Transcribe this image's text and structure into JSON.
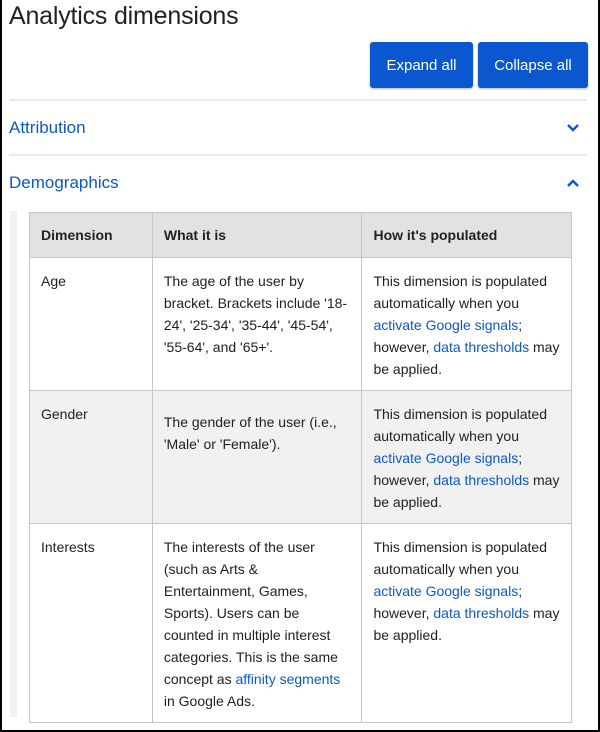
{
  "page": {
    "title": "Analytics dimensions"
  },
  "toolbar": {
    "expand_all_label": "Expand all",
    "collapse_all_label": "Collapse all"
  },
  "accordion": {
    "sections": [
      {
        "label": "Attribution",
        "expanded": false,
        "icon": "chevron-down-icon"
      },
      {
        "label": "Demographics",
        "expanded": true,
        "icon": "chevron-up-icon"
      }
    ]
  },
  "table": {
    "headers": [
      "Dimension",
      "What it is",
      "How it's populated"
    ],
    "rows": [
      {
        "dimension": "Age",
        "what_it_is": {
          "text": "The age of the user by bracket. Brackets include '18-24', '25-34', '35-44', '45-54', '55-64', and '65+'."
        },
        "how_populated": {
          "text_before": "This dimension is populated automatically when you ",
          "link1": "activate Google signals",
          "text_middle": "; however, ",
          "link2": "data thresholds",
          "text_after": " may be applied."
        }
      },
      {
        "dimension": "Gender",
        "what_it_is": {
          "text": "The gender of the user (i.e., 'Male' or 'Female')."
        },
        "how_populated": {
          "text_before": "This dimension is populated automatically when you ",
          "link1": "activate Google signals",
          "text_middle": "; however, ",
          "link2": "data thresholds",
          "text_after": " may be applied."
        }
      },
      {
        "dimension": "Interests",
        "what_it_is": {
          "text_before": "The interests of the user (such as Arts & Entertainment, Games, Sports). Users can be counted in multiple interest categories. This is the same concept as ",
          "link": "affinity segments",
          "text_after": " in Google Ads."
        },
        "how_populated": {
          "text_before": "This dimension is populated automatically when you ",
          "link1": "activate Google signals",
          "text_middle": "; however, ",
          "link2": "data thresholds",
          "text_after": " may be applied."
        }
      }
    ]
  },
  "colors": {
    "accent": "#0b57d0",
    "header_bg": "#e2e2e2",
    "shaded_row_bg": "#f1f1f1",
    "border": "#c6c6c6",
    "divider": "#e8eaed"
  }
}
